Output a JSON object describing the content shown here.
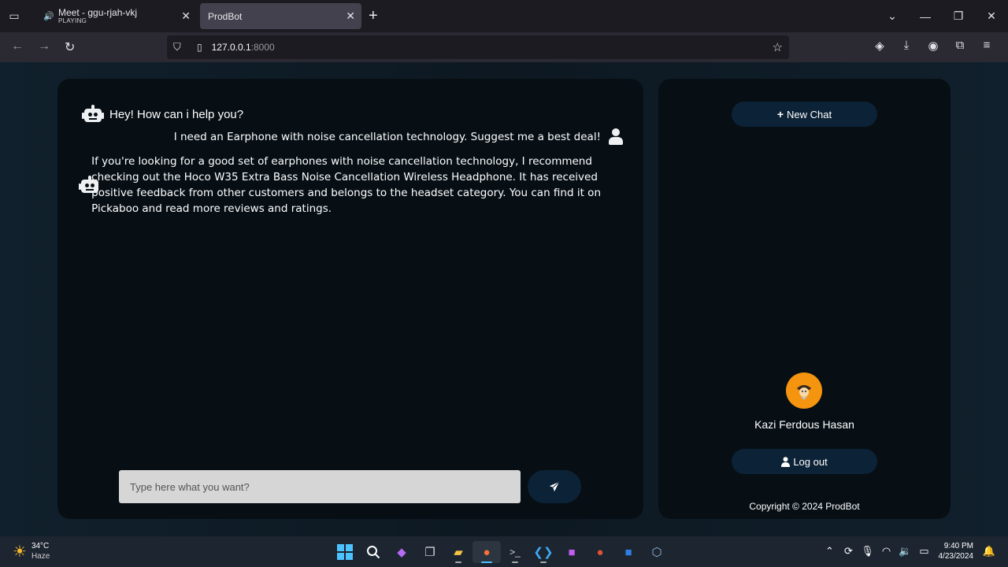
{
  "browser": {
    "tabs": [
      {
        "title": "Meet - ggu-rjah-vkj",
        "subtitle": "PLAYING"
      },
      {
        "title": "ProdBot"
      }
    ],
    "url_host": "127.0.0.1",
    "url_port": ":8000"
  },
  "chat": {
    "greeting": "Hey! How can i help you?",
    "user_message": "I need an Earphone with noise cancellation technology. Suggest me a best deal!",
    "bot_reply": "If you're looking for a good set of earphones with noise cancellation technology, I recommend checking out the Hoco W35 Extra Bass Noise Cancellation Wireless Headphone. It has received positive feedback from other customers and belongs to the headset category. You can find it on Pickaboo and read more reviews and ratings.",
    "input_placeholder": "Type here what you want?"
  },
  "sidebar": {
    "new_chat_label": "New Chat",
    "username": "Kazi Ferdous Hasan",
    "logout_label": "Log out",
    "copyright": "Copyright © 2024 ProdBot"
  },
  "taskbar": {
    "temperature": "34°C",
    "weather": "Haze",
    "time": "9:40 PM",
    "date": "4/23/2024"
  },
  "colors": {
    "panel_bg": "#070f15",
    "button_bg": "#0c2236",
    "avatar_bg": "#f5940f"
  }
}
